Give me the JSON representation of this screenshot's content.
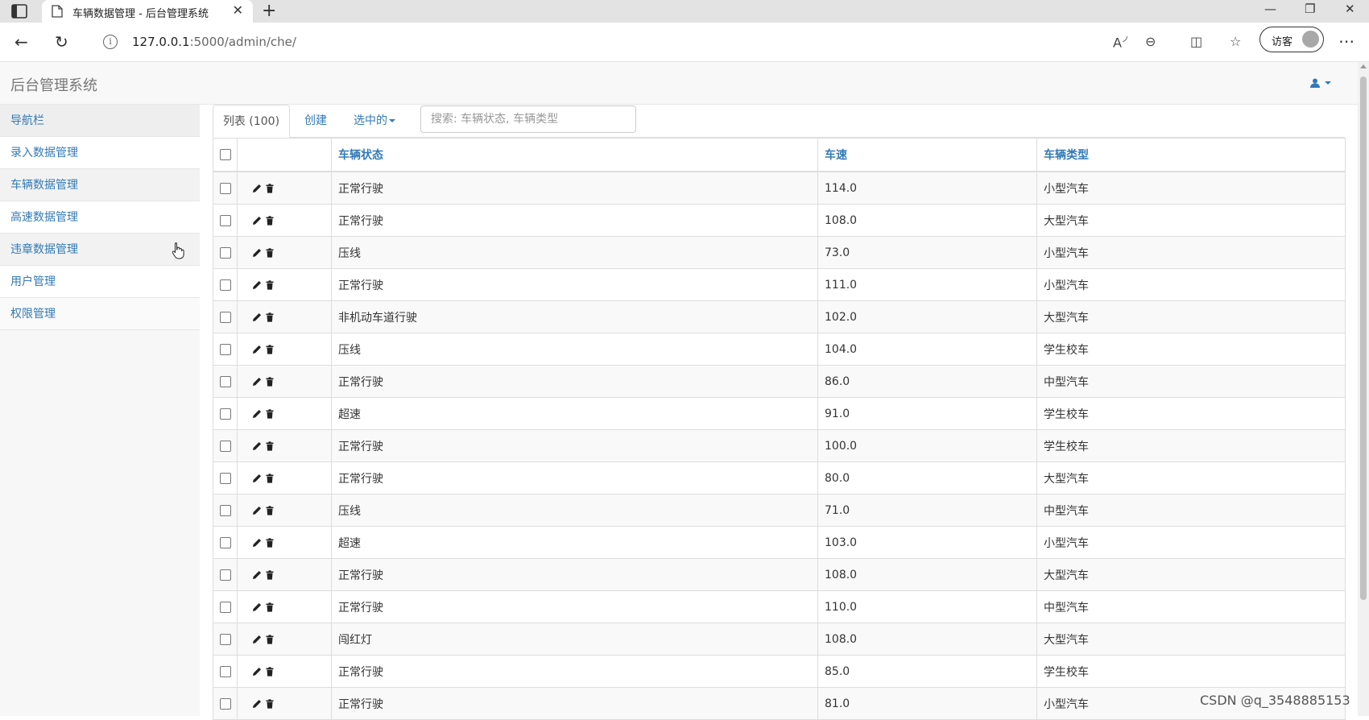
{
  "browser": {
    "tab_title": "车辆数据管理 - 后台管理系统",
    "url_host": "127.0.0.1",
    "url_rest": ":5000/admin/che/",
    "guest_label": "访客"
  },
  "app": {
    "brand": "后台管理系统"
  },
  "sidebar": {
    "items": [
      {
        "label": "导航栏"
      },
      {
        "label": "录入数据管理"
      },
      {
        "label": "车辆数据管理"
      },
      {
        "label": "高速数据管理"
      },
      {
        "label": "违章数据管理"
      },
      {
        "label": "用户管理"
      },
      {
        "label": "权限管理"
      }
    ]
  },
  "toolbar": {
    "list_tab": "列表 (100)",
    "create_tab": "创建",
    "selected_tab": "选中的",
    "search_placeholder": "搜索: 车辆状态, 车辆类型"
  },
  "table": {
    "columns": [
      "车辆状态",
      "车速",
      "车辆类型"
    ],
    "rows": [
      [
        "正常行驶",
        "114.0",
        "小型汽车"
      ],
      [
        "正常行驶",
        "108.0",
        "大型汽车"
      ],
      [
        "压线",
        "73.0",
        "小型汽车"
      ],
      [
        "正常行驶",
        "111.0",
        "小型汽车"
      ],
      [
        "非机动车道行驶",
        "102.0",
        "大型汽车"
      ],
      [
        "压线",
        "104.0",
        "学生校车"
      ],
      [
        "正常行驶",
        "86.0",
        "中型汽车"
      ],
      [
        "超速",
        "91.0",
        "学生校车"
      ],
      [
        "正常行驶",
        "100.0",
        "学生校车"
      ],
      [
        "正常行驶",
        "80.0",
        "大型汽车"
      ],
      [
        "压线",
        "71.0",
        "中型汽车"
      ],
      [
        "超速",
        "103.0",
        "小型汽车"
      ],
      [
        "正常行驶",
        "108.0",
        "大型汽车"
      ],
      [
        "正常行驶",
        "110.0",
        "中型汽车"
      ],
      [
        "闯红灯",
        "108.0",
        "大型汽车"
      ],
      [
        "正常行驶",
        "85.0",
        "学生校车"
      ],
      [
        "正常行驶",
        "81.0",
        "小型汽车"
      ]
    ]
  },
  "watermark": "CSDN @q_3548885153",
  "colors": {
    "link": "#337ab7"
  }
}
